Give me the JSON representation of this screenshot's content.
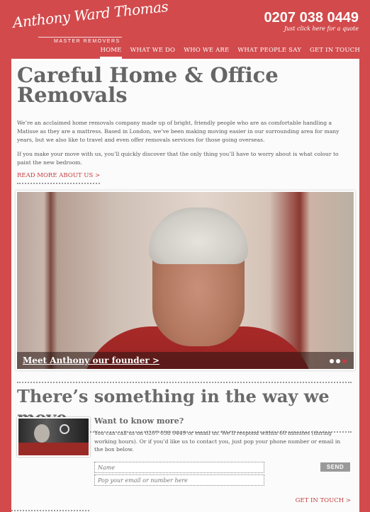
{
  "header": {
    "logo_script": "Anthony Ward Thomas",
    "logo_sub": "MASTER REMOVERS",
    "phone": "0207 038 0449",
    "phone_sub": "Just click here for a quote"
  },
  "nav": {
    "items": [
      "HOME",
      "WHAT WE DO",
      "WHO WE ARE",
      "WHAT PEOPLE SAY",
      "GET IN TOUCH"
    ],
    "active": "HOME"
  },
  "intro": {
    "title": "Careful Home & Office Removals",
    "p1": "We’re an acclaimed home removals company made up of bright, friendly people who are as comfortable handling a Matisse as they are a mattress. Based in London, we’ve been making moving easier in our surrounding area for many years, but we also like to travel and even offer removals services for those going overseas.",
    "p2": "If you make your move with us, you’ll quickly discover that the only thing you’ll have to worry about is what colour to paint the new bedroom.",
    "read_more": "READ MORE ABOUT US >"
  },
  "hero": {
    "caption": "Meet Anthony our founder  >",
    "slides": 3,
    "active_slide": 3
  },
  "contact": {
    "section_title": "There’s something in the way we move…",
    "heading": "Want to know more?",
    "text": "You can call us on 0207 038 0449 or email us. We’ll respond within 60 minutes (during working hours). Or if you’d like us to contact you, just pop your phone number or email in the box below.",
    "name_placeholder": "Name",
    "contact_placeholder": "Pop your email or number here",
    "send_label": "SEND",
    "get_in_touch": "GET IN TOUCH >"
  },
  "colors": {
    "background": "#d24a4c",
    "accent": "#c43c3e",
    "card": "#fbfbfb"
  }
}
